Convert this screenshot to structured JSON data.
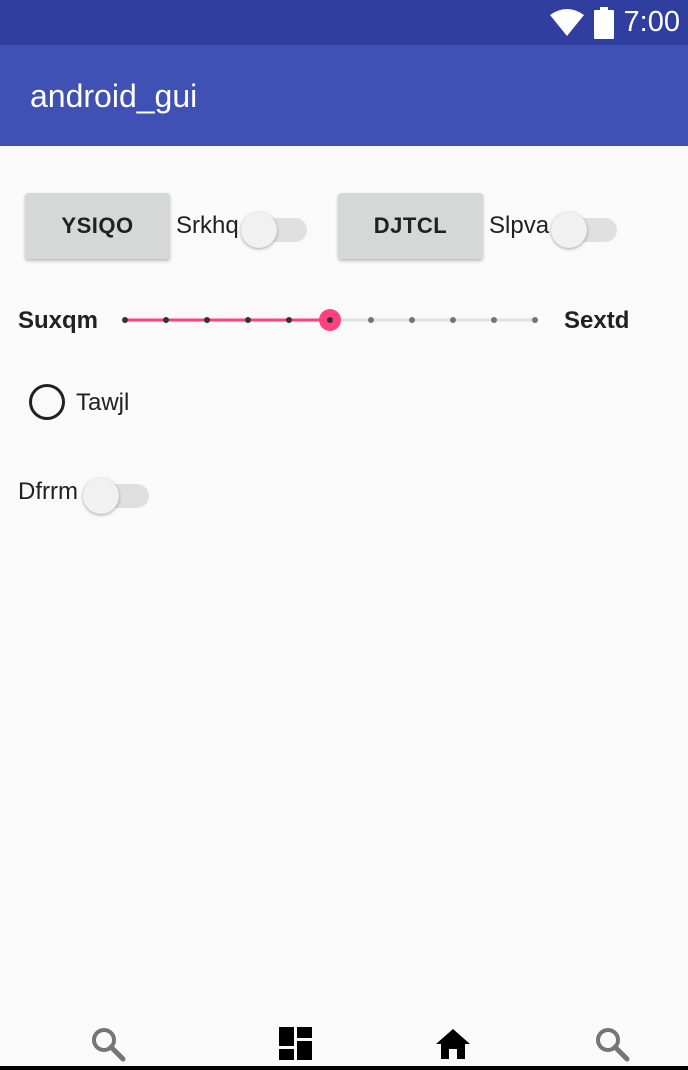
{
  "status_bar": {
    "time": "7:00",
    "icons": [
      "wifi-icon",
      "battery-icon"
    ],
    "color": "#303f9f"
  },
  "app_bar": {
    "title": "android_gui",
    "color": "#3f51b5"
  },
  "row1": {
    "button1_label": "YSIQO",
    "switch1_label": "Srkhq",
    "switch1_on": false,
    "button2_label": "DJTCL",
    "switch2_label": "Slpva",
    "switch2_on": false
  },
  "seekbar": {
    "left_label": "Suxqm",
    "right_label": "Sextd",
    "steps": 10,
    "value": 5,
    "accent": "#ff4081"
  },
  "radio": {
    "label": "Tawjl",
    "checked": false
  },
  "switch3": {
    "label": "Dfrrm",
    "on": false
  },
  "bottom_nav": {
    "icons": [
      "search-icon",
      "dashboard-icon",
      "home-icon",
      "search-icon"
    ]
  }
}
